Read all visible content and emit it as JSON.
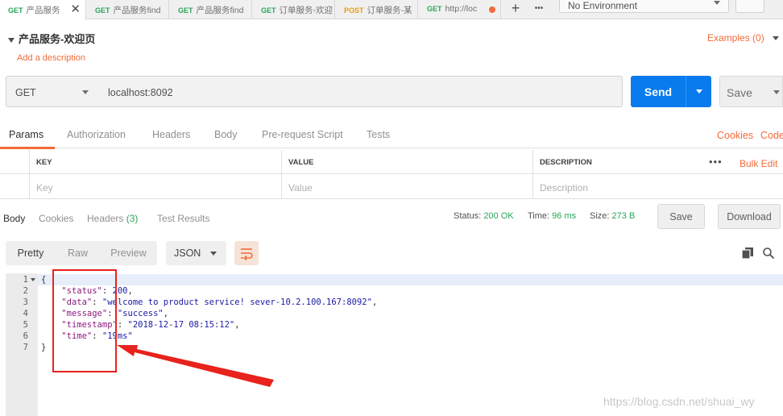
{
  "tabs": [
    {
      "method": "GET",
      "name": "产品服务",
      "active": true
    },
    {
      "method": "GET",
      "name": "产品服务find"
    },
    {
      "method": "GET",
      "name": "产品服务find"
    },
    {
      "method": "GET",
      "name": "订单服务-欢迎"
    },
    {
      "method": "POST",
      "name": "订单服务-某"
    },
    {
      "method": "GET",
      "name": "http://loc",
      "unsaved": true
    }
  ],
  "toolbar": {
    "add_icon": "+",
    "more_icon": "•••"
  },
  "environment": {
    "selected": "No Environment"
  },
  "request": {
    "name": "产品服务-欢迎页",
    "add_description": "Add a description",
    "examples": "Examples (0)",
    "method": "GET",
    "url": "localhost:8092",
    "send": "Send",
    "save": "Save"
  },
  "req_tabs": [
    "Params",
    "Authorization",
    "Headers",
    "Body",
    "Pre-request Script",
    "Tests"
  ],
  "req_links": {
    "cookies": "Cookies",
    "code": "Code"
  },
  "params": {
    "headers": [
      "KEY",
      "VALUE",
      "DESCRIPTION"
    ],
    "placeholders": [
      "Key",
      "Value",
      "Description"
    ],
    "bulk_edit": "Bulk Edit",
    "more": "•••"
  },
  "response": {
    "tabs": [
      {
        "label": "Body"
      },
      {
        "label": "Cookies"
      },
      {
        "label": "Headers",
        "count": "(3)"
      },
      {
        "label": "Test Results"
      }
    ],
    "status_label": "Status:",
    "status": "200 OK",
    "time_label": "Time:",
    "time": "96 ms",
    "size_label": "Size:",
    "size": "273 B",
    "save": "Save",
    "download": "Download",
    "views": [
      "Pretty",
      "Raw",
      "Preview"
    ],
    "format": "JSON",
    "lines": [
      "1",
      "2",
      "3",
      "4",
      "5",
      "6",
      "7"
    ],
    "json": {
      "status_key": "\"status\"",
      "status_val": "200",
      "data_key": "\"data\"",
      "data_val": "\"welcome to product service! sever-10.2.100.167:8092\"",
      "message_key": "\"message\"",
      "message_val": "\"success\"",
      "timestamp_key": "\"timestamp\"",
      "timestamp_val": "\"2018-12-17 08:15:12\"",
      "time_key": "\"time\"",
      "time_val": "\"19ms\""
    }
  },
  "colors": {
    "accent": "#f26b3a",
    "send": "#097bed",
    "ok": "#2ba65a",
    "annotation": "#e8221c"
  },
  "watermark": "https://blog.csdn.net/shuai_wy"
}
